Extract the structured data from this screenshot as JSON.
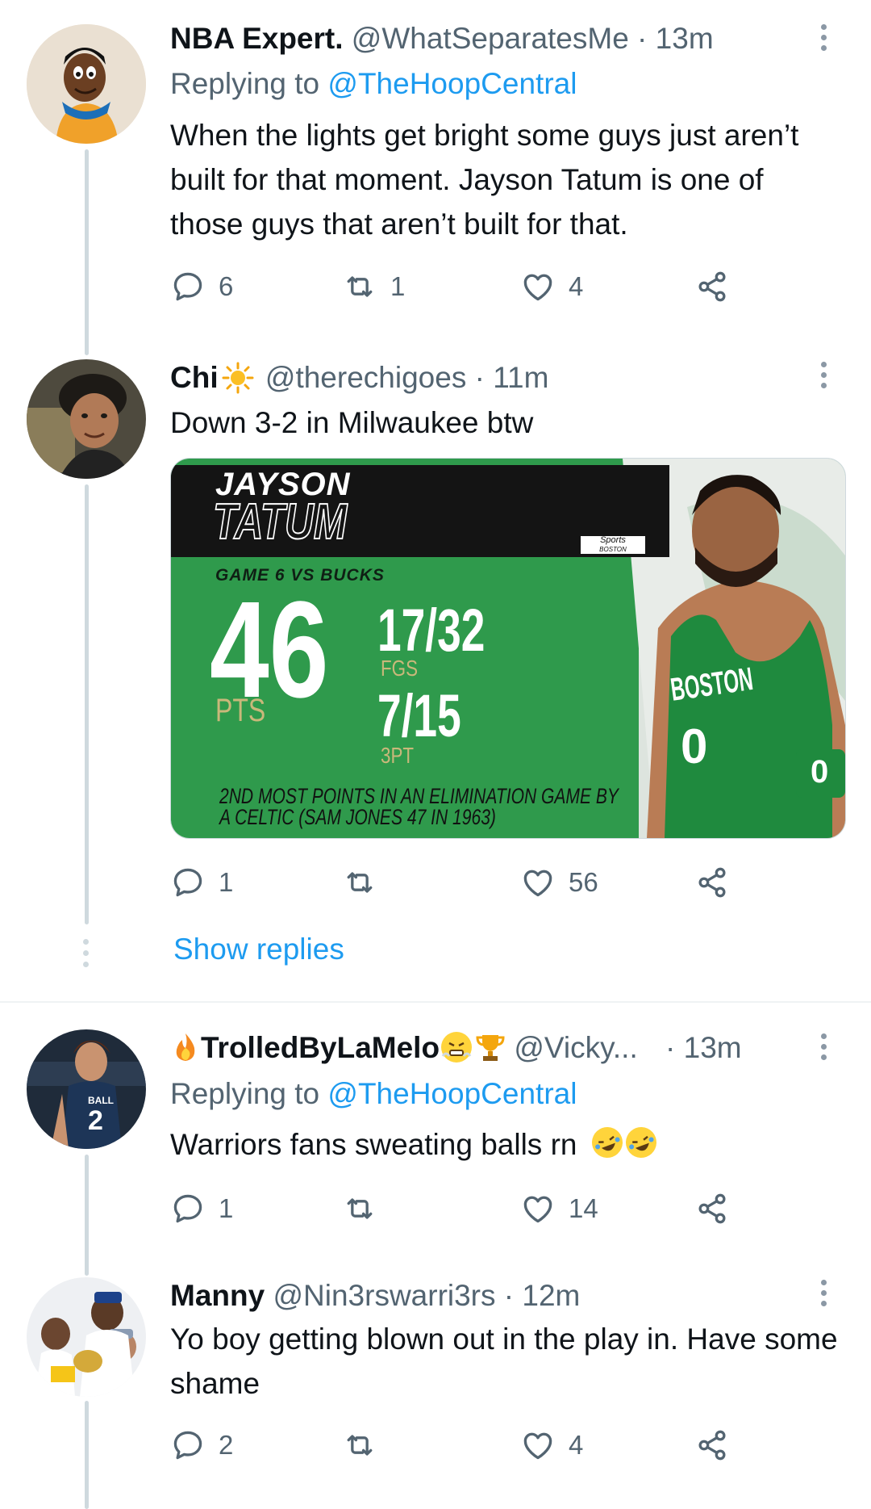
{
  "tweets": [
    {
      "name": "NBA Expert.",
      "handle": "@WhatSeparatesMe",
      "time": "13m",
      "replying_prefix": "Replying to ",
      "replying_to": "@TheHoopCentral",
      "text": "When the lights get bright some guys just aren’t built for that moment. Jayson Tatum is one of those guys that aren’t built for that.",
      "replies": "6",
      "retweets": "1",
      "likes": "4"
    },
    {
      "name": "Chi",
      "handle": "@therechigoes",
      "time": "11m",
      "text": "Down 3-2 in Milwaukee btw",
      "replies": "1",
      "retweets": "",
      "likes": "56",
      "media": {
        "first_name": "JAYSON",
        "last_name": "TATUM",
        "game": "GAME 6 VS BUCKS",
        "points": "46",
        "points_label": "PTS",
        "fg": "17/32",
        "fg_label": "FGS",
        "three": "7/15",
        "three_label": "3PT",
        "caption_line1": "2ND MOST POINTS IN AN ELIMINATION GAME BY",
        "caption_line2": "A CELTIC (SAM JONES 47 IN 1963)",
        "network_line1": "Sports",
        "network_line2": "BOSTON",
        "jersey_text": "BOSTON",
        "jersey_number": "0",
        "wristband": "0"
      }
    },
    {
      "name": "TrolledByLaMelo",
      "handle": "@Vicky...",
      "time": "13m",
      "replying_prefix": "Replying to ",
      "replying_to": "@TheHoopCentral",
      "text": "Warriors fans sweating balls rn",
      "replies": "1",
      "retweets": "",
      "likes": "14",
      "avatar_jersey_number": "2",
      "avatar_jersey_name": "BALL"
    },
    {
      "name": "Manny",
      "handle": "@Nin3rswarri3rs",
      "time": "12m",
      "text": "Yo boy getting blown out in the play in. Have some shame",
      "replies": "2",
      "retweets": "",
      "likes": "4"
    }
  ],
  "show_replies": "Show replies",
  "dot_separator": " · ",
  "colors": {
    "link": "#1d9bf0",
    "secondary": "#536471",
    "celtics_green": "#2f9a4c"
  },
  "icons": [
    "reply-icon",
    "retweet-icon",
    "like-icon",
    "share-icon",
    "more-icon"
  ]
}
